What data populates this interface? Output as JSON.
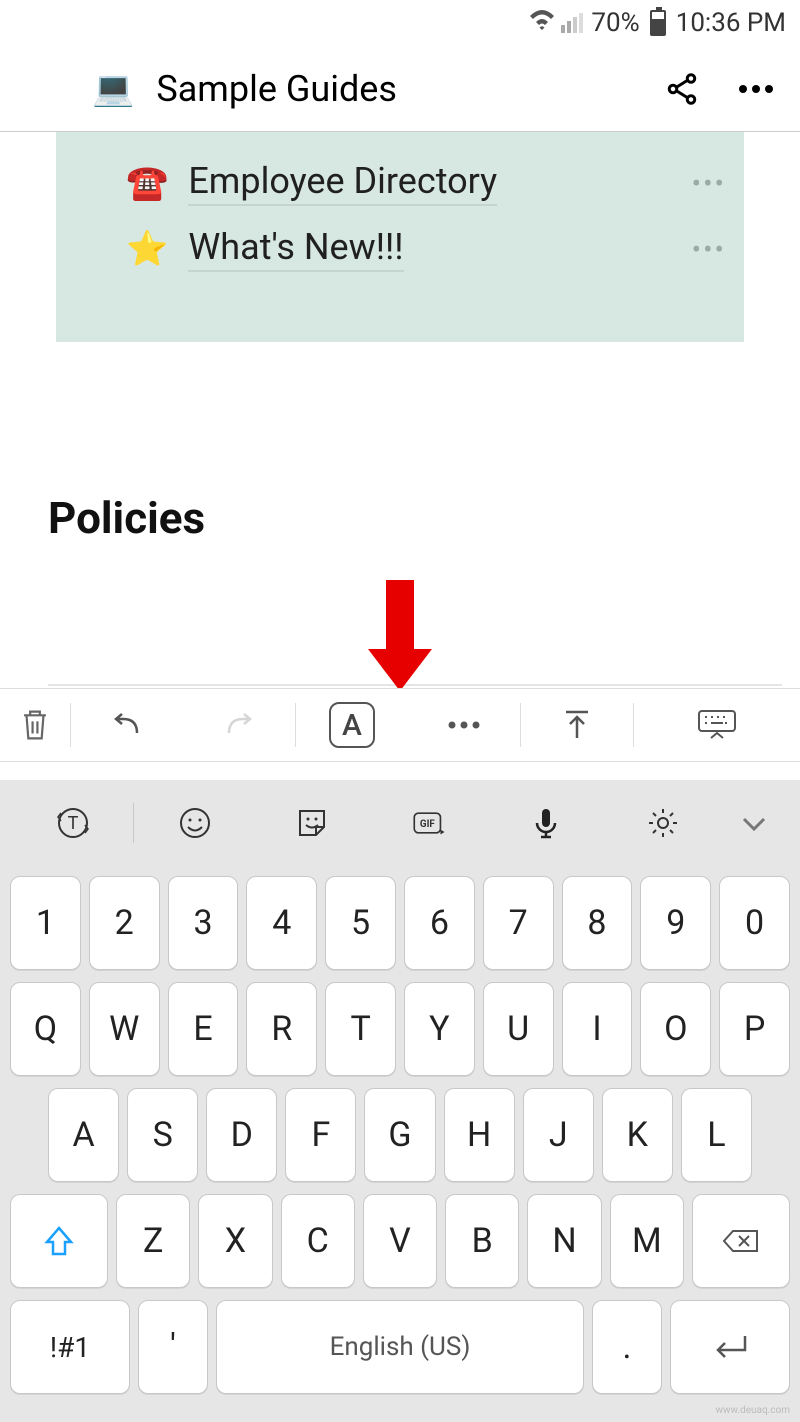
{
  "status": {
    "battery": "70%",
    "time": "10:36 PM"
  },
  "appbar": {
    "title": "Sample Guides"
  },
  "card": {
    "items": [
      {
        "emoji": "☎️",
        "label": "Employee Directory"
      },
      {
        "emoji": "⭐",
        "label": "What's New!!!"
      }
    ]
  },
  "heading": "Policies",
  "fmt": {
    "A": "A"
  },
  "keyboard": {
    "row1": [
      "1",
      "2",
      "3",
      "4",
      "5",
      "6",
      "7",
      "8",
      "9",
      "0"
    ],
    "row2": [
      "Q",
      "W",
      "E",
      "R",
      "T",
      "Y",
      "U",
      "I",
      "O",
      "P"
    ],
    "row3": [
      "A",
      "S",
      "D",
      "F",
      "G",
      "H",
      "J",
      "K",
      "L"
    ],
    "row4": [
      "Z",
      "X",
      "C",
      "V",
      "B",
      "N",
      "M"
    ],
    "sym": "!#1",
    "apos": "'",
    "space": "English (US)",
    "dot": "."
  },
  "watermark": "www.deuaq.com"
}
